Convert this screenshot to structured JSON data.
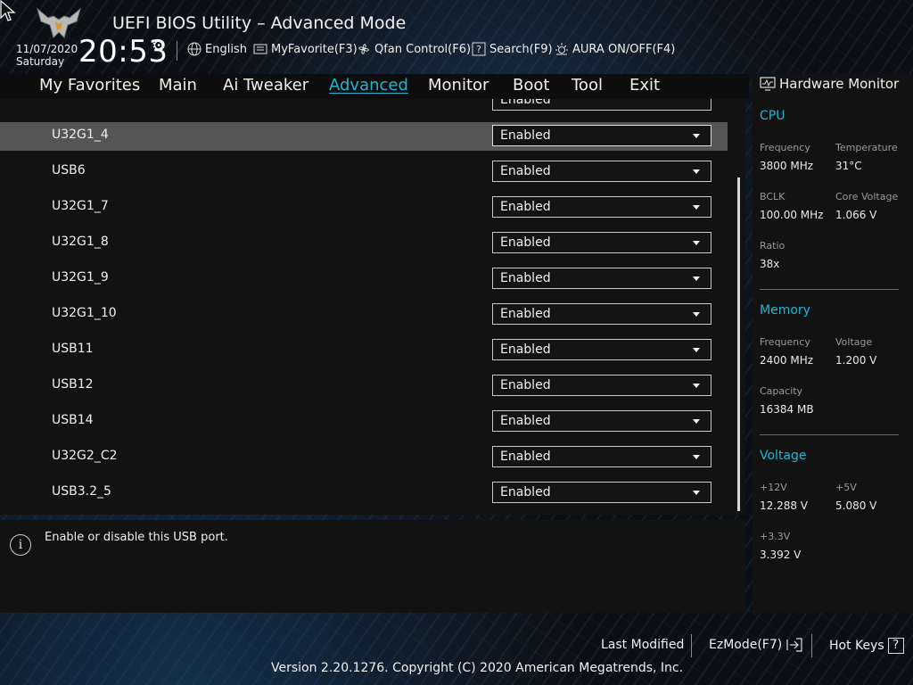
{
  "header": {
    "title": "UEFI BIOS Utility – Advanced Mode",
    "date": "11/07/2020",
    "day": "Saturday",
    "time": "20:53",
    "items": {
      "language": "English",
      "myfavorite": "MyFavorite(F3)",
      "qfan": "Qfan Control(F6)",
      "search": "Search(F9)",
      "aura": "AURA ON/OFF(F4)"
    }
  },
  "nav": {
    "tabs": [
      "My Favorites",
      "Main",
      "Ai Tweaker",
      "Advanced",
      "Monitor",
      "Boot",
      "Tool",
      "Exit"
    ],
    "active": "Advanced"
  },
  "settings": {
    "partial_row": {
      "value": "Enabled"
    },
    "rows": [
      {
        "label": "U32G1_4",
        "value": "Enabled",
        "selected": true
      },
      {
        "label": "USB6",
        "value": "Enabled"
      },
      {
        "label": "U32G1_7",
        "value": "Enabled"
      },
      {
        "label": "U32G1_8",
        "value": "Enabled"
      },
      {
        "label": "U32G1_9",
        "value": "Enabled"
      },
      {
        "label": "U32G1_10",
        "value": "Enabled"
      },
      {
        "label": "USB11",
        "value": "Enabled"
      },
      {
        "label": "USB12",
        "value": "Enabled"
      },
      {
        "label": "USB14",
        "value": "Enabled"
      },
      {
        "label": "U32G2_C2",
        "value": "Enabled"
      },
      {
        "label": "USB3.2_5",
        "value": "Enabled"
      }
    ]
  },
  "help": {
    "text": "Enable or disable this USB port."
  },
  "hardware_monitor": {
    "title": "Hardware Monitor",
    "cpu": {
      "heading": "CPU",
      "frequency_label": "Frequency",
      "frequency": "3800 MHz",
      "temperature_label": "Temperature",
      "temperature": "31°C",
      "bclk_label": "BCLK",
      "bclk": "100.00 MHz",
      "core_voltage_label": "Core Voltage",
      "core_voltage": "1.066 V",
      "ratio_label": "Ratio",
      "ratio": "38x"
    },
    "memory": {
      "heading": "Memory",
      "frequency_label": "Frequency",
      "frequency": "2400 MHz",
      "voltage_label": "Voltage",
      "voltage": "1.200 V",
      "capacity_label": "Capacity",
      "capacity": "16384 MB"
    },
    "voltage": {
      "heading": "Voltage",
      "v12_label": "+12V",
      "v12": "12.288 V",
      "v5_label": "+5V",
      "v5": "5.080 V",
      "v33_label": "+3.3V",
      "v33": "3.392 V"
    }
  },
  "footer": {
    "last_modified": "Last Modified",
    "ezmode": "EzMode(F7)",
    "hotkeys": "Hot Keys",
    "hotkeys_glyph": "?",
    "copyright": "Version 2.20.1276. Copyright (C) 2020 American Megatrends, Inc."
  },
  "colors": {
    "accent": "#1fb6d6",
    "selected_row": "#555555",
    "panel": "#121212"
  }
}
